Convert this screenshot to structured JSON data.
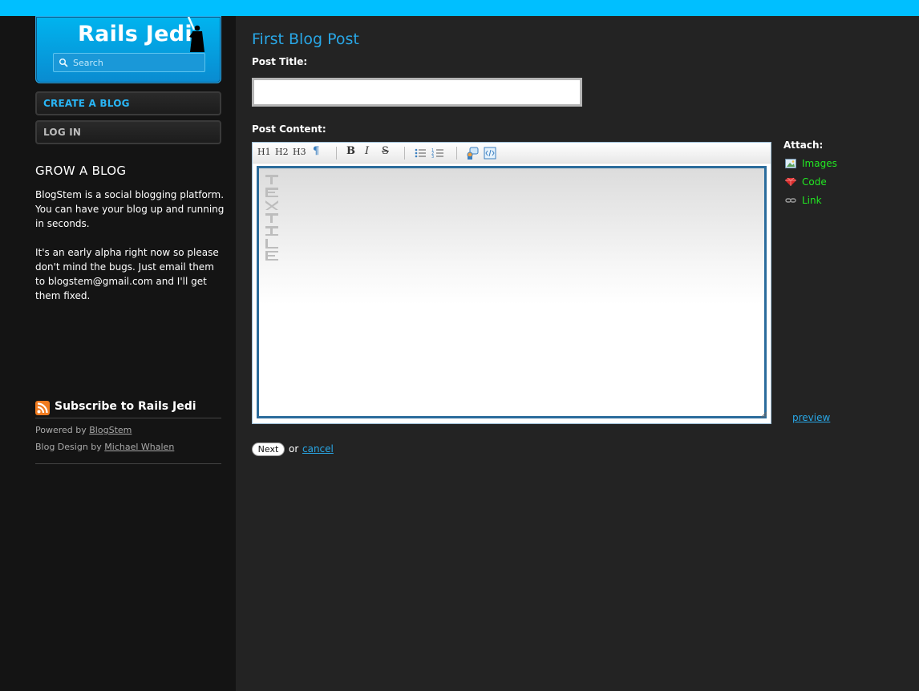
{
  "brand": {
    "title": "Rails Jedi",
    "logo_icon": "jedi-silhouette-icon",
    "search_placeholder": "Search"
  },
  "nav": {
    "create_label": "Create a Blog",
    "login_label": "Log In"
  },
  "promo": {
    "title": "GROW A BLOG",
    "paragraph1": "BlogStem is a social blogging platform. You can have your blog up and running in seconds.",
    "paragraph2": "It's an early alpha right now so please don't mind the bugs. Just email them to blogstem@gmail.com and I'll get them fixed."
  },
  "footer": {
    "subscribe_label": "Subscribe to Rails Jedi",
    "powered_prefix": "Powered by",
    "powered_link": "BlogStem",
    "design_prefix": "Blog Design by",
    "design_link": "Michael Whalen"
  },
  "post": {
    "heading": "First Blog Post",
    "title_label": "Post Title:",
    "title_value": "",
    "content_label": "Post Content:",
    "content_value": ""
  },
  "toolbar": {
    "h1": "H1",
    "h2": "H2",
    "h3": "H3",
    "paragraph": "¶",
    "bold": "B",
    "italic": "I",
    "strike": "S"
  },
  "attach": {
    "label": "Attach:",
    "images": "Images",
    "code": "Code",
    "link": "Link"
  },
  "preview_label": "preview",
  "actions": {
    "next_label": "Next",
    "or_text": "or",
    "cancel_label": "cancel"
  },
  "colors": {
    "top_bar": "#00bfff",
    "accent_blue": "#29a7e6",
    "attach_green": "#22e822",
    "sidebar_bg": "#141414",
    "main_bg": "#232323"
  }
}
